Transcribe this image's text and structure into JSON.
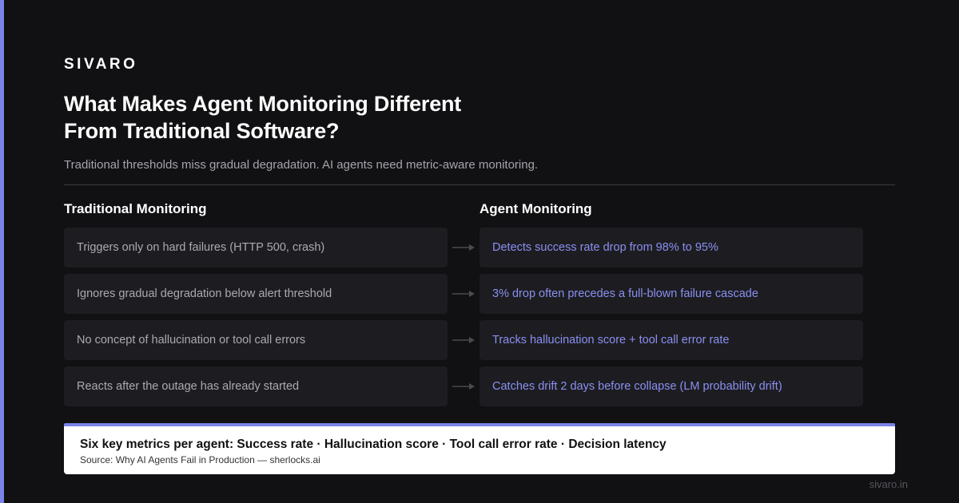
{
  "brand": "SIVARO",
  "headline": {
    "line1": "What Makes Agent Monitoring Different",
    "line2": "From Traditional Software?"
  },
  "subtitle": "Traditional thresholds miss gradual degradation. AI agents need metric-aware monitoring.",
  "columns": {
    "left": "Traditional Monitoring",
    "right": "Agent Monitoring"
  },
  "rows": [
    {
      "traditional": "Triggers only on hard failures (HTTP 500, crash)",
      "agent": "Detects success rate drop from 98% to 95%"
    },
    {
      "traditional": "Ignores gradual degradation below alert threshold",
      "agent": "3% drop often precedes a full-blown failure cascade"
    },
    {
      "traditional": "No concept of hallucination or tool call errors",
      "agent": "Tracks hallucination score + tool call error rate"
    },
    {
      "traditional": "Reacts after the outage has already started",
      "agent": "Catches drift 2 days before collapse (LM probability drift)"
    }
  ],
  "callout": {
    "title": "Six key metrics per agent: Success rate · Hallucination score · Tool call error rate · Decision latency",
    "source": "Source: Why AI Agents Fail in Production — sherlocks.ai"
  },
  "footer": "sivaro.in",
  "colors": {
    "background": "#111113",
    "accent": "#7b83e8",
    "card": "#1d1d21",
    "agent_text": "#8a8ff0",
    "traditional_text": "#a9a9b0"
  },
  "icons": {
    "row_connector": "arrow-right-icon"
  }
}
